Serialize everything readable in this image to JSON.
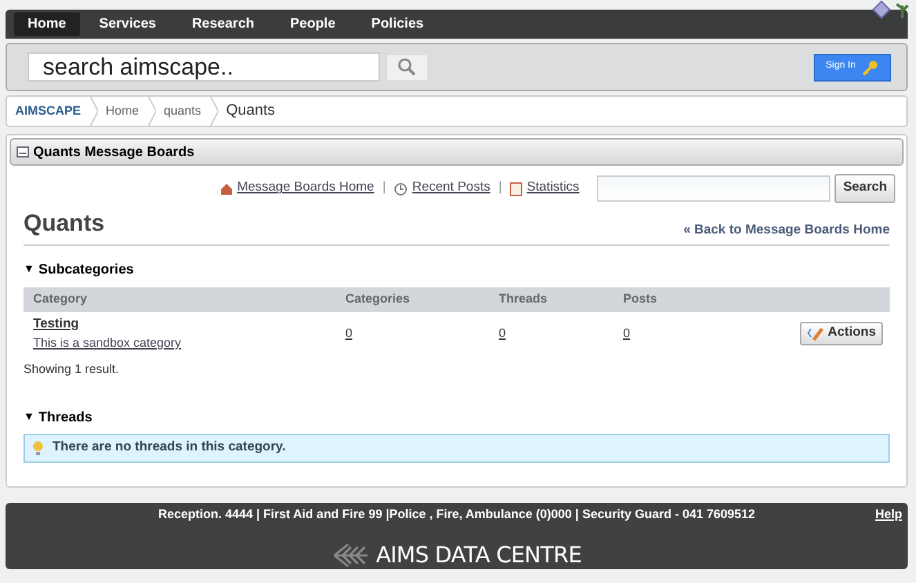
{
  "nav": [
    {
      "label": "Home",
      "selected": true
    },
    {
      "label": "Services",
      "selected": false
    },
    {
      "label": "Research",
      "selected": false
    },
    {
      "label": "People",
      "selected": false
    },
    {
      "label": "Policies",
      "selected": false
    }
  ],
  "search": {
    "placeholder": "search aimscape.."
  },
  "sign_in": "Sign In",
  "breadcrumb": [
    "AIMSCAPE",
    "Home",
    "quants",
    "Quants"
  ],
  "panel_title": "Quants Message Boards",
  "link_separators": [
    "|",
    "|"
  ],
  "links": [
    {
      "kind": "home",
      "label": "Message Boards Home"
    },
    {
      "kind": "recent",
      "label": "Recent Posts"
    },
    {
      "kind": "stats",
      "label": "Statistics"
    }
  ],
  "board_search_button": "Search",
  "heading": "Quants",
  "back_link": "« Back to Message Boards Home",
  "subcategories": {
    "marker": "▼",
    "title": "Subcategories",
    "columns": [
      "Category",
      "Categories",
      "Threads",
      "Posts"
    ],
    "rows": [
      {
        "name": "Testing",
        "description": "This is a sandbox category",
        "categories": "0",
        "threads": "0",
        "posts": "0",
        "action": "Actions"
      }
    ],
    "result": "Showing 1 result."
  },
  "threads": {
    "marker": "▼",
    "title": "Threads",
    "message": "There are no threads in this category."
  },
  "footer": {
    "contacts": "Reception. 4444 | First Aid and Fire 99 |Police , Fire, Ambulance (0)000 | Security Guard - 041 7609512",
    "help": "Help",
    "logo": "AIMS DATA CENTRE"
  }
}
